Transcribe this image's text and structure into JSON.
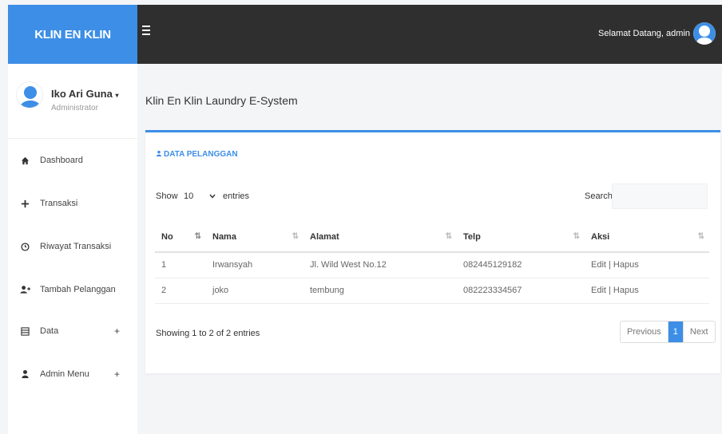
{
  "brand": "KLIN EN KLIN",
  "topbar": {
    "welcome": "Selamat Datang, admin"
  },
  "user": {
    "name": "Iko Ari Guna",
    "role": "Administrator"
  },
  "menu": [
    {
      "label": "Dashboard",
      "icon": "home-icon",
      "expandable": false
    },
    {
      "label": "Transaksi",
      "icon": "plus-icon",
      "expandable": false
    },
    {
      "label": "Riwayat Transaksi",
      "icon": "clock-icon",
      "expandable": false
    },
    {
      "label": "Tambah Pelanggan",
      "icon": "add-user-icon",
      "expandable": false
    },
    {
      "label": "Data",
      "icon": "list-icon",
      "expandable": true,
      "toggle": "+"
    },
    {
      "label": "Admin Menu",
      "icon": "user-icon",
      "expandable": true,
      "toggle": "+"
    }
  ],
  "page_title": "Klin En Klin Laundry E-System",
  "card": {
    "title": "DATA PELANGGAN",
    "show_label": "Show",
    "page_length": "10",
    "entries_label": "entries",
    "search_label": "Search:",
    "search_value": ""
  },
  "table": {
    "columns": [
      "No",
      "Nama",
      "Alamat",
      "Telp",
      "Aksi"
    ],
    "rows": [
      {
        "no": "1",
        "nama": "Irwansyah",
        "alamat": "Jl. Wild West No.12",
        "telp": "082445129182",
        "aksi": "Edit | Hapus"
      },
      {
        "no": "2",
        "nama": "joko",
        "alamat": "tembung",
        "telp": "082223334567",
        "aksi": "Edit | Hapus"
      }
    ]
  },
  "info": "Showing 1 to 2 of 2 entries",
  "pagination": {
    "previous": "Previous",
    "current": "1",
    "next": "Next"
  },
  "colors": {
    "accent": "#3d8ee6",
    "topbar": "#2f2f2f",
    "background": "#f4f5f7"
  }
}
